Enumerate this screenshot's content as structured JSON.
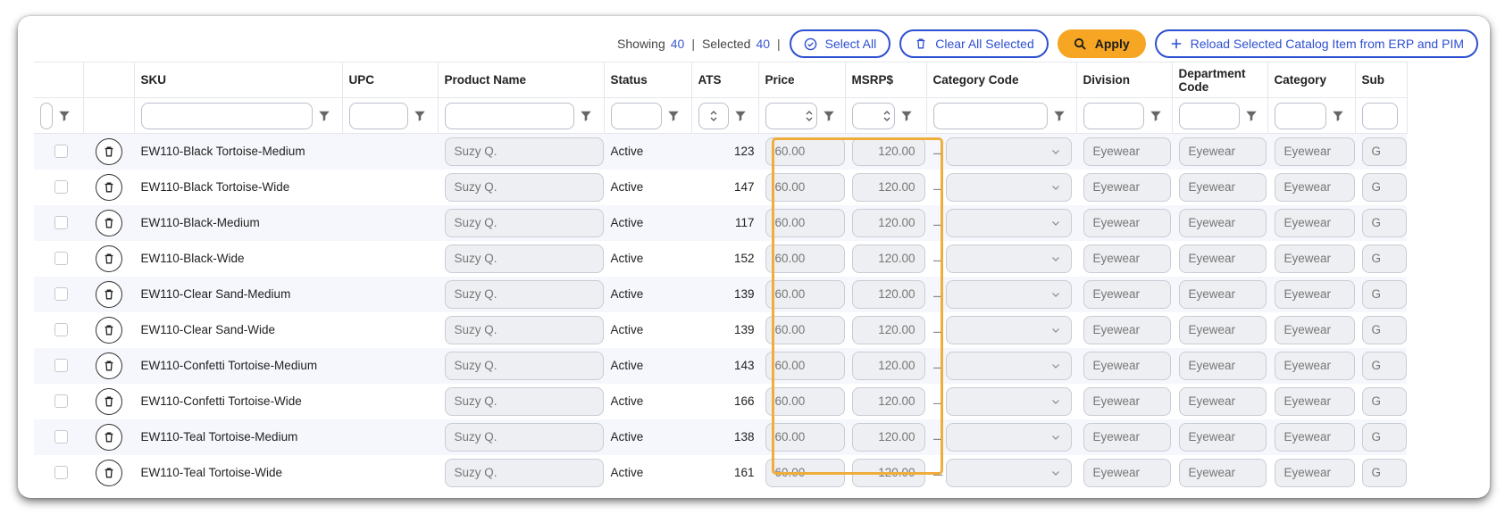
{
  "toolbar": {
    "showing_label": "Showing",
    "showing_count": "40",
    "selected_label": "Selected",
    "selected_count": "40",
    "separator": "|",
    "select_all": "Select All",
    "clear_all": "Clear All Selected",
    "apply": "Apply",
    "reload": "Reload Selected Catalog Item from ERP and PIM"
  },
  "columns": {
    "sku": "SKU",
    "upc": "UPC",
    "product_name": "Product Name",
    "status": "Status",
    "ats": "ATS",
    "price": "Price",
    "msrp": "MSRP$",
    "category_code": "Category Code",
    "division": "Division",
    "department_code": "Department Code",
    "category": "Category",
    "subcategory_partial": "Sub"
  },
  "rows": [
    {
      "sku": "EW110-Black Tortoise-Medium",
      "product_name": "Suzy Q.",
      "status": "Active",
      "ats": "123",
      "price": "60.00",
      "msrp": "120.00",
      "category_code": ".....",
      "division": "Eyewear",
      "department_code": "Eyewear",
      "category": "Eyewear",
      "sub": "G"
    },
    {
      "sku": "EW110-Black Tortoise-Wide",
      "product_name": "Suzy Q.",
      "status": "Active",
      "ats": "147",
      "price": "60.00",
      "msrp": "120.00",
      "category_code": ".....",
      "division": "Eyewear",
      "department_code": "Eyewear",
      "category": "Eyewear",
      "sub": "G"
    },
    {
      "sku": "EW110-Black-Medium",
      "product_name": "Suzy Q.",
      "status": "Active",
      "ats": "117",
      "price": "60.00",
      "msrp": "120.00",
      "category_code": ".....",
      "division": "Eyewear",
      "department_code": "Eyewear",
      "category": "Eyewear",
      "sub": "G"
    },
    {
      "sku": "EW110-Black-Wide",
      "product_name": "Suzy Q.",
      "status": "Active",
      "ats": "152",
      "price": "60.00",
      "msrp": "120.00",
      "category_code": ".....",
      "division": "Eyewear",
      "department_code": "Eyewear",
      "category": "Eyewear",
      "sub": "G"
    },
    {
      "sku": "EW110-Clear Sand-Medium",
      "product_name": "Suzy Q.",
      "status": "Active",
      "ats": "139",
      "price": "60.00",
      "msrp": "120.00",
      "category_code": ".....",
      "division": "Eyewear",
      "department_code": "Eyewear",
      "category": "Eyewear",
      "sub": "G"
    },
    {
      "sku": "EW110-Clear Sand-Wide",
      "product_name": "Suzy Q.",
      "status": "Active",
      "ats": "139",
      "price": "60.00",
      "msrp": "120.00",
      "category_code": ".....",
      "division": "Eyewear",
      "department_code": "Eyewear",
      "category": "Eyewear",
      "sub": "G"
    },
    {
      "sku": "EW110-Confetti Tortoise-Medium",
      "product_name": "Suzy Q.",
      "status": "Active",
      "ats": "143",
      "price": "60.00",
      "msrp": "120.00",
      "category_code": ".....",
      "division": "Eyewear",
      "department_code": "Eyewear",
      "category": "Eyewear",
      "sub": "G"
    },
    {
      "sku": "EW110-Confetti Tortoise-Wide",
      "product_name": "Suzy Q.",
      "status": "Active",
      "ats": "166",
      "price": "60.00",
      "msrp": "120.00",
      "category_code": ".....",
      "division": "Eyewear",
      "department_code": "Eyewear",
      "category": "Eyewear",
      "sub": "G"
    },
    {
      "sku": "EW110-Teal Tortoise-Medium",
      "product_name": "Suzy Q.",
      "status": "Active",
      "ats": "138",
      "price": "60.00",
      "msrp": "120.00",
      "category_code": ".....",
      "division": "Eyewear",
      "department_code": "Eyewear",
      "category": "Eyewear",
      "sub": "G"
    },
    {
      "sku": "EW110-Teal Tortoise-Wide",
      "product_name": "Suzy Q.",
      "status": "Active",
      "ats": "161",
      "price": "60.00",
      "msrp": "120.00",
      "category_code": ".....",
      "division": "Eyewear",
      "department_code": "Eyewear",
      "category": "Eyewear",
      "sub": "G"
    }
  ],
  "colors": {
    "accent_blue": "#2d4fd1",
    "apply_orange": "#f6a623",
    "highlight_orange": "#f0ad3c"
  }
}
